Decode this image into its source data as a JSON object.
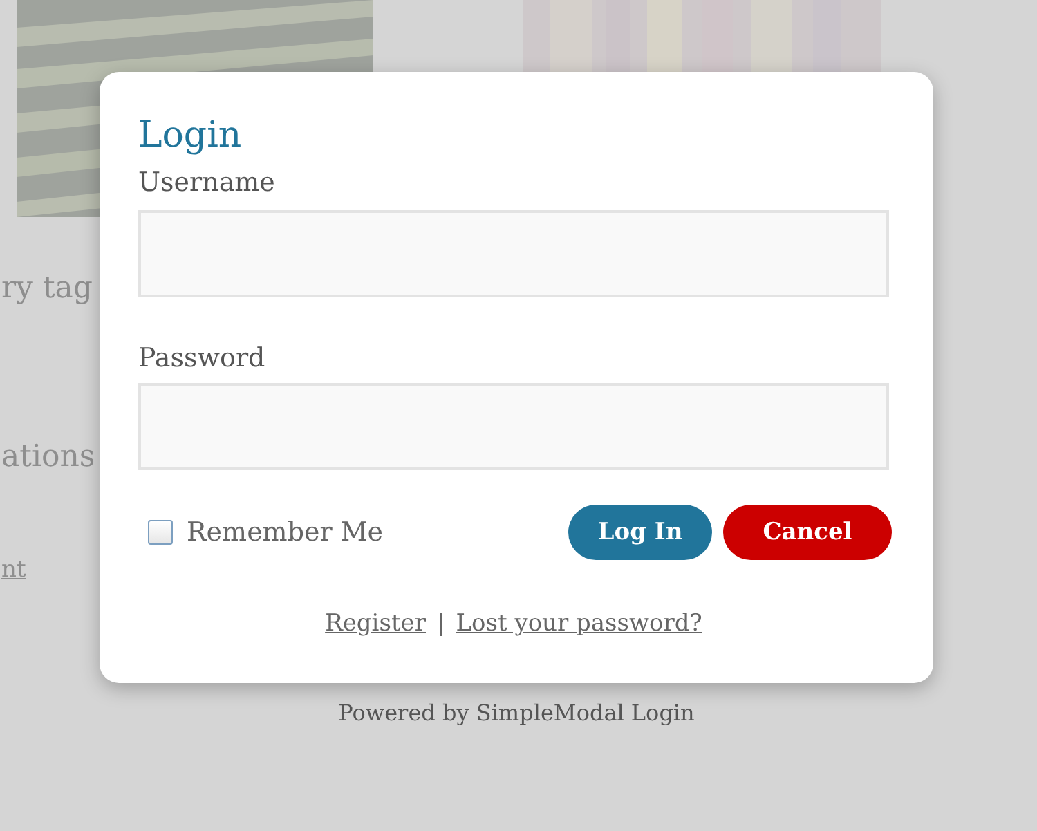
{
  "background": {
    "texts": [
      {
        "text": "ry tag",
        "kind": "text"
      },
      {
        "text": "ations",
        "kind": "text"
      },
      {
        "text": "nt",
        "kind": "link"
      }
    ]
  },
  "modal": {
    "title": "Login",
    "fields": [
      {
        "label": "Username"
      },
      {
        "label": "Password"
      }
    ],
    "remember": {
      "label": "Remember Me",
      "checked": false
    },
    "buttons": [
      {
        "label": "Log In",
        "kind": "primary"
      },
      {
        "label": "Cancel",
        "kind": "cancel"
      }
    ],
    "links": [
      {
        "text": "Register"
      },
      {
        "text": "Lost your password?"
      }
    ],
    "separator": "|"
  },
  "footer": "Powered by SimpleModal Login"
}
